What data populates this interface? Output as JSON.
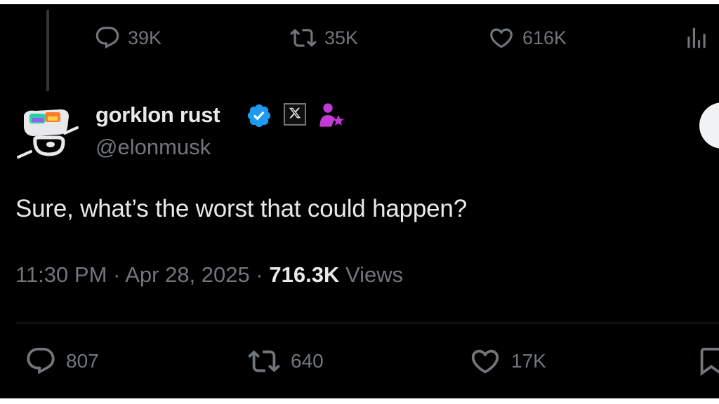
{
  "parent_tweet": {
    "actions": {
      "replies": "39K",
      "reposts": "35K",
      "likes": "616K"
    }
  },
  "tweet": {
    "author": {
      "display_name": "gorklon rust",
      "handle": "@elonmusk",
      "verified": true,
      "affiliate_badge": "X"
    },
    "text": "Sure, what’s the worst that could happen?",
    "time": "11:30 PM",
    "separator": "·",
    "date": "Apr 28, 2025",
    "views_count": "716.3K",
    "views_label": "Views",
    "actions": {
      "replies": "807",
      "reposts": "640",
      "likes": "17K"
    }
  },
  "icons": {
    "reply": "reply-icon",
    "repost": "repost-icon",
    "like": "heart-icon",
    "views": "analytics-icon",
    "bookmark": "bookmark-icon",
    "verified": "verified-badge-icon",
    "affiliate": "x-logo-icon",
    "person": "person-star-icon"
  },
  "colors": {
    "background": "#000000",
    "text_primary": "#e7e9ea",
    "text_secondary": "#71767b",
    "verified_blue": "#1d9bf0",
    "accent_magenta": "#c239d6",
    "divider": "#2f3336"
  }
}
